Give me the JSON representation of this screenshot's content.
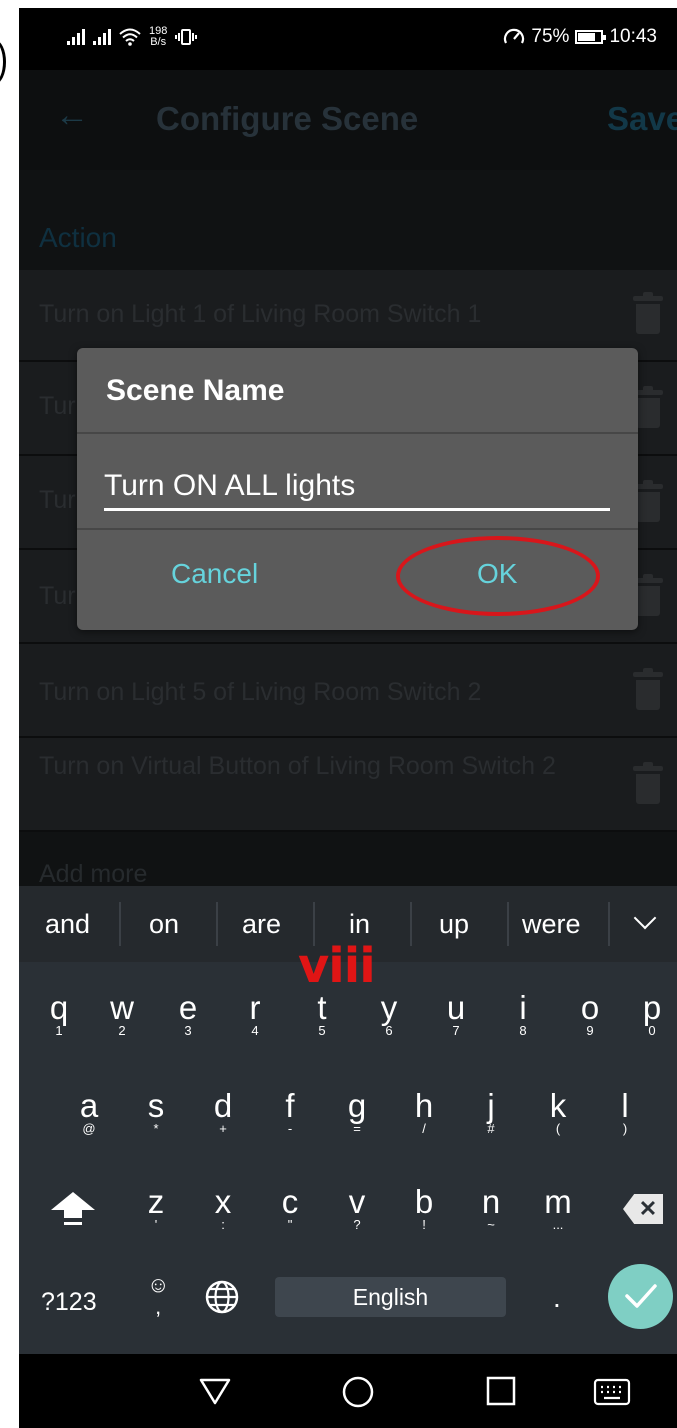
{
  "status_bar": {
    "network_speed_value": "198",
    "network_speed_unit": "B/s",
    "battery": "75%",
    "time": "10:43",
    "icons": [
      "signal-1-icon",
      "signal-2-icon",
      "wifi-icon",
      "vibrate-icon",
      "data-saver-icon",
      "battery-icon"
    ]
  },
  "app_bar": {
    "title": "Configure Scene",
    "save_label": "Save",
    "back_icon": "arrow-left-icon"
  },
  "section": {
    "label": "Action",
    "rows": [
      {
        "text": "Turn on Light 1 of Living Room Switch 1"
      },
      {
        "text": "Tur"
      },
      {
        "text": "Tur"
      },
      {
        "text": "Tur"
      },
      {
        "text": "Turn on Light 5 of Living Room Switch 2"
      },
      {
        "text": "Turn on Virtual Button of Living Room Switch 2"
      }
    ],
    "add_more": "Add more"
  },
  "dialog": {
    "title": "Scene Name",
    "input_value": "Turn ON ALL lights",
    "cancel_label": "Cancel",
    "ok_label": "OK",
    "annotation_color": "#d8161b"
  },
  "keyboard": {
    "suggestions": [
      "and",
      "on",
      "are",
      "in",
      "up",
      "were"
    ],
    "row1": [
      {
        "m": "q",
        "s": "1"
      },
      {
        "m": "w",
        "s": "2"
      },
      {
        "m": "e",
        "s": "3"
      },
      {
        "m": "r",
        "s": "4"
      },
      {
        "m": "t",
        "s": "5"
      },
      {
        "m": "y",
        "s": "6"
      },
      {
        "m": "u",
        "s": "7"
      },
      {
        "m": "i",
        "s": "8"
      },
      {
        "m": "o",
        "s": "9"
      },
      {
        "m": "p",
        "s": "0"
      }
    ],
    "row2": [
      {
        "m": "a",
        "s": "@"
      },
      {
        "m": "s",
        "s": "*"
      },
      {
        "m": "d",
        "s": "+"
      },
      {
        "m": "f",
        "s": "-"
      },
      {
        "m": "g",
        "s": "="
      },
      {
        "m": "h",
        "s": "/"
      },
      {
        "m": "j",
        "s": "#"
      },
      {
        "m": "k",
        "s": "("
      },
      {
        "m": "l",
        "s": ")"
      }
    ],
    "row3": [
      {
        "m": "z",
        "s": "'"
      },
      {
        "m": "x",
        "s": ":"
      },
      {
        "m": "c",
        "s": "\""
      },
      {
        "m": "v",
        "s": "?"
      },
      {
        "m": "b",
        "s": "!"
      },
      {
        "m": "n",
        "s": "~"
      },
      {
        "m": "m",
        "s": "..."
      }
    ],
    "symbols_label": "?123",
    "emoji_main": "☺",
    "emoji_sub": ",",
    "space_label": "English",
    "period": ".",
    "accent": "#7fcfc4"
  },
  "annotation_label": "viii",
  "nav_bar": {
    "icons": [
      "back-triangle-icon",
      "home-circle-icon",
      "recents-square-icon",
      "keyboard-icon"
    ]
  }
}
